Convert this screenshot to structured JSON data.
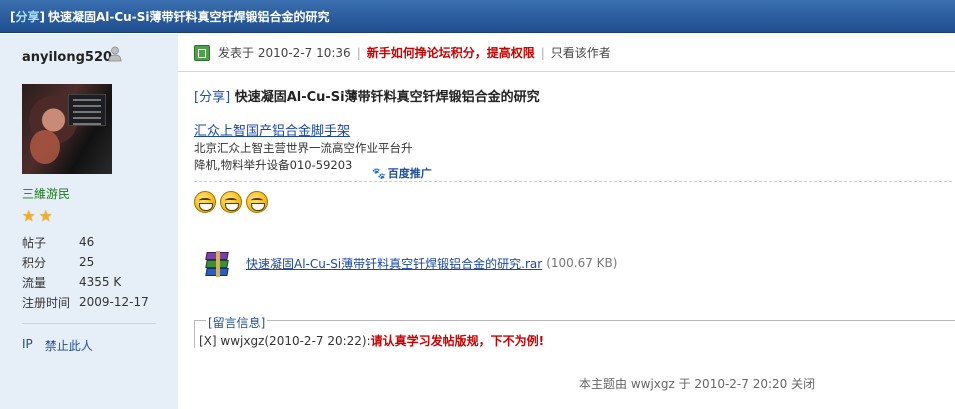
{
  "title": {
    "tag_left": "[",
    "tag": "分享",
    "tag_right": "]",
    "text": "快速凝固Al-Cu-Si薄带钎料真空钎焊锻铝合金的研究"
  },
  "user": {
    "name": "anyilong520",
    "rank": "三維游民",
    "stars": 2,
    "stats": [
      {
        "label": "帖子",
        "value": "46"
      },
      {
        "label": "积分",
        "value": "25"
      },
      {
        "label": "流量",
        "value": "4355 K"
      },
      {
        "label": "注册时间",
        "value": "2009-12-17"
      }
    ],
    "links": {
      "ip": "IP",
      "ban": "禁止此人"
    }
  },
  "post": {
    "posted_at": "发表于  2010-2-7 10:36",
    "promo": "新手如何挣论坛积分，提高权限",
    "only_author": "只看该作者",
    "subject_tag": "[分享]",
    "subject": "快速凝固Al-Cu-Si薄带钎料真空钎焊锻铝合金的研究",
    "ad": {
      "title": "汇众上智国产铝合金脚手架",
      "line1": "北京汇众上智主营世界一流高空作业平台升",
      "line2": "降机,物料举升设备010-59203",
      "badge": "百度推广"
    },
    "emoticon_count": 3,
    "attachment": {
      "name": "快速凝固Al-Cu-Si薄带钎料真空钎焊锻铝合金的研究.rar",
      "size": "(100.67 KB)"
    },
    "message": {
      "legend": "[留言信息]",
      "prefix": "[X] wwjxgz(2010-2-7 20:22):",
      "text": "请认真学习发帖版规，下不为例!"
    },
    "closed_note": "本主题由  wwjxgz 于  2010-2-7 20:20 关闭"
  },
  "colors": {
    "title_bg": "#2a5c9c",
    "user_bg": "#e6eef8",
    "link": "#1a47a8",
    "alert": "#cc0000"
  }
}
